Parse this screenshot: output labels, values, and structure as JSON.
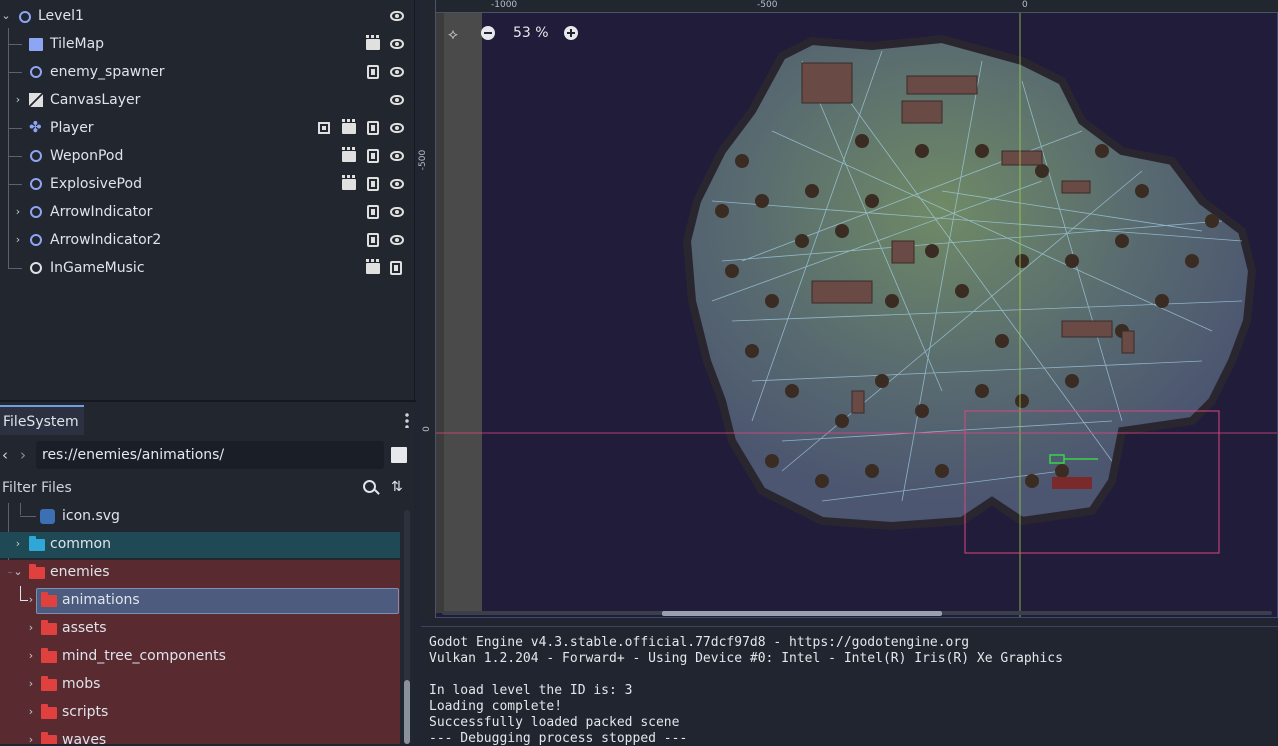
{
  "scene_tree": {
    "nodes": [
      {
        "label": "Level1"
      },
      {
        "label": "TileMap"
      },
      {
        "label": "enemy_spawner"
      },
      {
        "label": "CanvasLayer"
      },
      {
        "label": "Player"
      },
      {
        "label": "WeponPod"
      },
      {
        "label": "ExplosivePod"
      },
      {
        "label": "ArrowIndicator"
      },
      {
        "label": "ArrowIndicator2"
      },
      {
        "label": "InGameMusic"
      }
    ]
  },
  "filesystem": {
    "tab_label": "FileSystem",
    "path": "res://enemies/animations/",
    "filter_placeholder": "Filter Files",
    "items": [
      {
        "label": "icon.svg"
      },
      {
        "label": "common"
      },
      {
        "label": "enemies"
      },
      {
        "label": "animations"
      },
      {
        "label": "assets"
      },
      {
        "label": "mind_tree_components"
      },
      {
        "label": "mobs"
      },
      {
        "label": "scripts"
      },
      {
        "label": "waves"
      }
    ]
  },
  "viewport": {
    "zoom": "53 %",
    "ruler_top": [
      "-1000",
      "-500",
      "0"
    ],
    "ruler_left": [
      "-500",
      "0"
    ]
  },
  "console": {
    "lines": [
      "Godot Engine v4.3.stable.official.77dcf97d8 - https://godotengine.org",
      "Vulkan 1.2.204 - Forward+ - Using Device #0: Intel - Intel(R) Iris(R) Xe Graphics",
      "",
      "In load level the ID is: 3",
      "Loading complete!",
      "Successfully loaded packed scene",
      "--- Debugging process stopped ---"
    ]
  },
  "colors": {
    "accent": "#6d9fde",
    "node_blue": "#8da5f3",
    "folder_cyan": "#2fa8d8",
    "folder_red": "#e0403e",
    "selected_row": "#4c5b7e",
    "enemies_bg": "#5a2a31",
    "common_bg": "#1f4a55"
  }
}
